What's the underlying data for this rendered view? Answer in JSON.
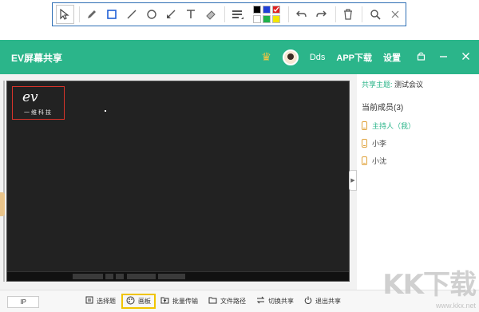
{
  "toolbar": {
    "tools": [
      "pointer-icon",
      "pen-icon",
      "rectangle-icon",
      "line-icon",
      "circle-icon",
      "arrow-icon",
      "text-icon",
      "eraser-icon",
      "line-width-icon"
    ],
    "palette": [
      "#000000",
      "#1f3fd6",
      "#e02020",
      "#ffffff",
      "#1fb24a",
      "#f2e600"
    ],
    "actions": [
      "undo-icon",
      "redo-icon",
      "delete-icon",
      "zoom-icon",
      "close-icon"
    ]
  },
  "app": {
    "title": "EV屏幕共享",
    "user_name": "Dds",
    "download_label": "APP下载",
    "settings_label": "设置"
  },
  "panel": {
    "topic_label": "共享主题:",
    "topic_value": "测试会议",
    "members_header": "当前成员(3)",
    "members": [
      {
        "name": "主持人（我）",
        "host": true
      },
      {
        "name": "小李",
        "host": false
      },
      {
        "name": "小沈",
        "host": false
      }
    ]
  },
  "screen": {
    "logo_mark": "ev",
    "logo_text": "一维科技"
  },
  "bottom": {
    "ip_label": "IP",
    "buttons": [
      {
        "label": "选择题",
        "icon": "quiz-icon"
      },
      {
        "label": "画板",
        "icon": "palette-icon",
        "selected": true
      },
      {
        "label": "批量传输",
        "icon": "folder-upload-icon"
      },
      {
        "label": "文件路径",
        "icon": "folder-icon"
      },
      {
        "label": "切换共享",
        "icon": "switch-icon"
      },
      {
        "label": "退出共享",
        "icon": "power-icon"
      }
    ]
  },
  "watermark": {
    "main": "KK下载",
    "url": "www.kkx.net"
  }
}
